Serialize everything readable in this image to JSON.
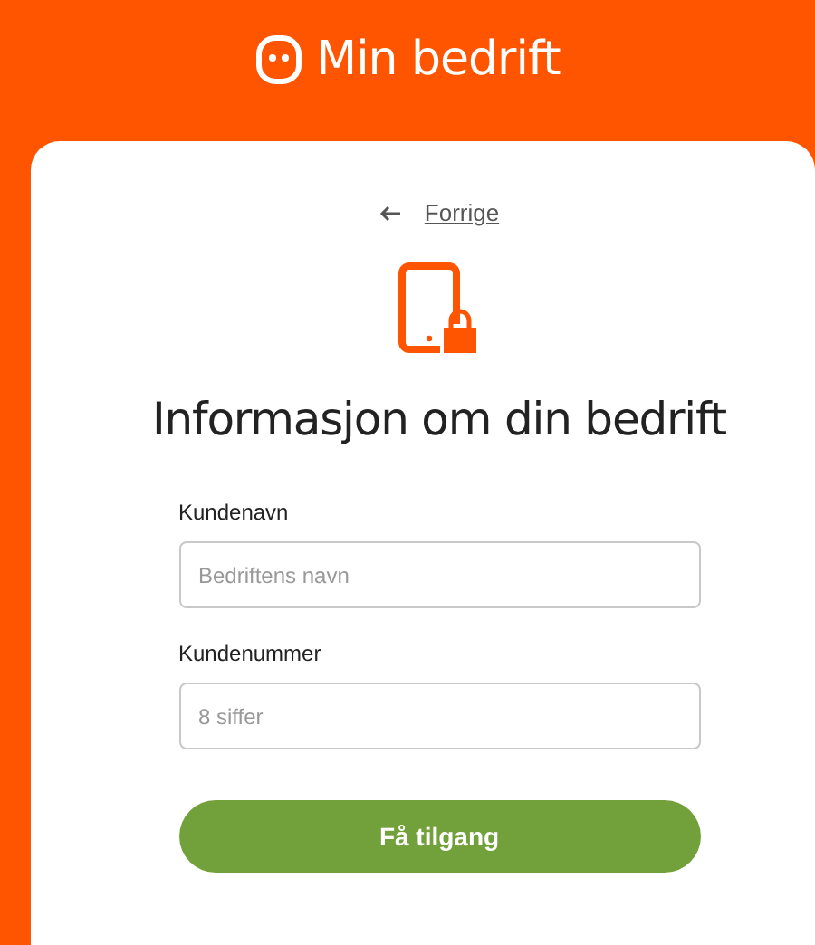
{
  "header": {
    "title": "Min bedrift"
  },
  "back_link": {
    "label": "Forrige"
  },
  "heading": "Informasjon om din bedrift",
  "fields": [
    {
      "label": "Kundenavn",
      "placeholder": "Bedriftens navn"
    },
    {
      "label": "Kundenummer",
      "placeholder": "8 siffer"
    }
  ],
  "submit": {
    "label": "Få tilgang"
  }
}
